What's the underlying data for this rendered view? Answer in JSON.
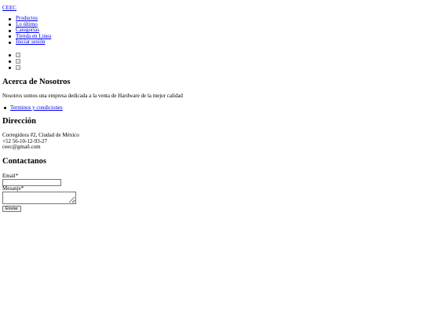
{
  "brand": "CEEC",
  "nav": {
    "items": [
      "Productos",
      "Lo último",
      "Categorias",
      "Tienda en Linea",
      "Iniciar sesión"
    ]
  },
  "images": {
    "count_note": "",
    "icon": "broken-image-icon"
  },
  "about": {
    "title": "Acerca de Nosotros",
    "text": "Nosotros somos una empresa dedicada a la venta de Hardware de la mejor calidad",
    "links": [
      "Terminos y condiciones"
    ]
  },
  "address": {
    "title": "Dirección",
    "line1": "Corregidora #2, Ciudad de México",
    "phone": "+52 56-10-12-93-27",
    "email": "ceec@gmail.com"
  },
  "contact": {
    "title": "Contactanos",
    "email_label": "Email*",
    "email_value": "",
    "message_label": "Mesanje*",
    "message_value": "",
    "submit_label": "Enviar"
  },
  "colors": {
    "link": "#0000ee",
    "text": "#000000",
    "background": "#ffffff"
  }
}
